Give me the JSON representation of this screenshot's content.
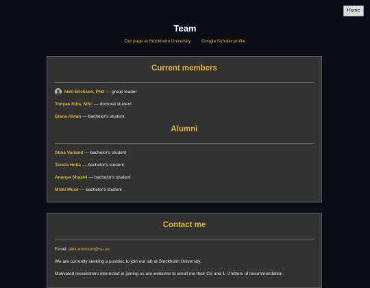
{
  "nav": {
    "home_label": "Home"
  },
  "header": {
    "title": "Team",
    "links": [
      {
        "label": "Our page at Stockholm University"
      },
      {
        "label": "Google Scholar profile"
      }
    ]
  },
  "members": {
    "heading": "Current members",
    "people": [
      {
        "name": "Alek Erickson, PhD",
        "role": "group leader",
        "avatar": "avatar-photo"
      },
      {
        "name": "Tonyak Riba, MSc",
        "role": "doctoral student"
      },
      {
        "name": "Diana Alwan",
        "role": "bachelor's student"
      }
    ]
  },
  "alumni": {
    "heading": "Alumni",
    "people": [
      {
        "name": "Stina Varland",
        "role": "bachelor's student"
      },
      {
        "name": "Tereza Holla",
        "role": "bachelor's student"
      },
      {
        "name": "Ananya Shastri",
        "role": "bachelor's student"
      },
      {
        "name": "Miski Muse",
        "role": "bachelor's student"
      }
    ]
  },
  "contact": {
    "heading": "Contact me",
    "email_label": "Email:",
    "email": "alek.erickson@su.se",
    "line1": "We are currently seeking a postdoc to join our lab at Stockholm University.",
    "line2": "Motivated researchers interested in joining us are welcome to email me their CV and 1–2 letters of recommendation."
  },
  "colors": {
    "background": "#0c0e18",
    "panel": "#333333",
    "accent": "#e0b232",
    "text": "#e6e6e6"
  },
  "separator": "—"
}
